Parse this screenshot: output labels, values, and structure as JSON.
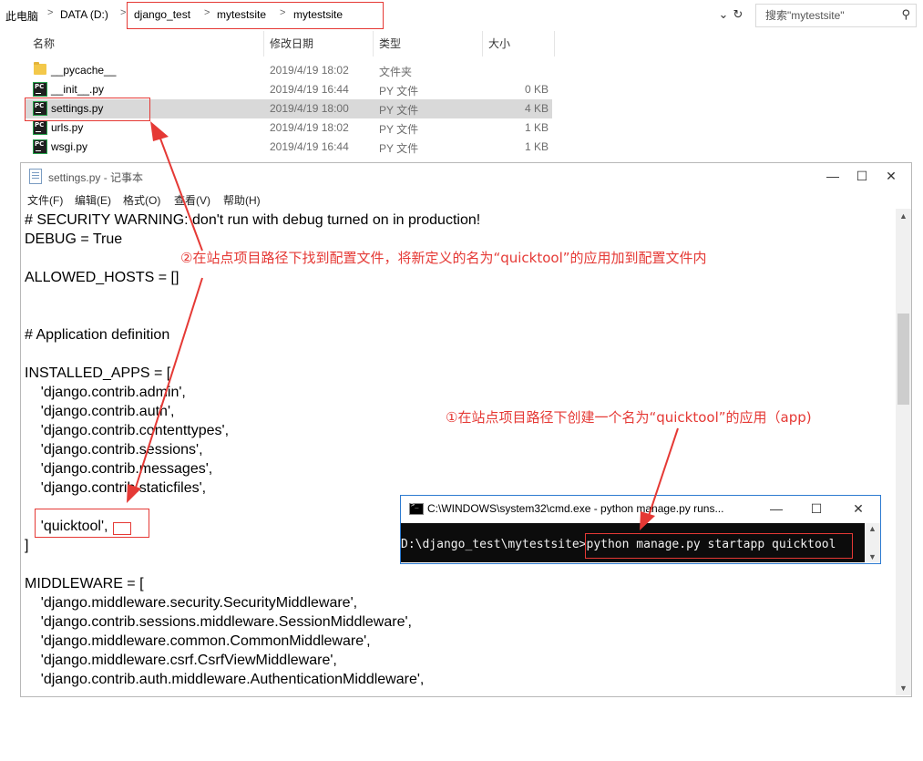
{
  "explorer": {
    "breadcrumbs": [
      "此电脑",
      "DATA (D:)",
      "django_test",
      "mytestsite",
      "mytestsite"
    ],
    "search_placeholder": "搜索\"mytestsite\"",
    "columns": {
      "name": "名称",
      "modified": "修改日期",
      "type": "类型",
      "size": "大小"
    },
    "files": [
      {
        "name": "__pycache__",
        "modified": "2019/4/19 18:02",
        "type": "文件夹",
        "size": "",
        "icon": "folder-icon"
      },
      {
        "name": "__init__.py",
        "modified": "2019/4/19 16:44",
        "type": "PY 文件",
        "size": "0 KB",
        "icon": "pycharm-file-icon"
      },
      {
        "name": "settings.py",
        "modified": "2019/4/19 18:00",
        "type": "PY 文件",
        "size": "4 KB",
        "icon": "pycharm-file-icon",
        "selected": true
      },
      {
        "name": "urls.py",
        "modified": "2019/4/19 18:02",
        "type": "PY 文件",
        "size": "1 KB",
        "icon": "pycharm-file-icon"
      },
      {
        "name": "wsgi.py",
        "modified": "2019/4/19 16:44",
        "type": "PY 文件",
        "size": "1 KB",
        "icon": "pycharm-file-icon"
      }
    ]
  },
  "notepad": {
    "title": "settings.py - 记事本",
    "menu": [
      "文件(F)",
      "编辑(E)",
      "格式(O)",
      "查看(V)",
      "帮助(H)"
    ],
    "lines": [
      "# SECURITY WARNING: don't run with debug turned on in production!",
      "DEBUG = True",
      "",
      "ALLOWED_HOSTS = []",
      "",
      "",
      "# Application definition",
      "",
      "INSTALLED_APPS = [",
      "    'django.contrib.admin',",
      "    'django.contrib.auth',",
      "    'django.contrib.contenttypes',",
      "    'django.contrib.sessions',",
      "    'django.contrib.messages',",
      "    'django.contrib.staticfiles',",
      "",
      "    'quicktool',",
      "]",
      "",
      "MIDDLEWARE = [",
      "    'django.middleware.security.SecurityMiddleware',",
      "    'django.contrib.sessions.middleware.SessionMiddleware',",
      "    'django.middleware.common.CommonMiddleware',",
      "    'django.middleware.csrf.CsrfViewMiddleware',",
      "    'django.contrib.auth.middleware.AuthenticationMiddleware',"
    ]
  },
  "cmd": {
    "title": "C:\\WINDOWS\\system32\\cmd.exe - python  manage.py runs...",
    "prompt": "D:\\django_test\\mytestsite>",
    "command": "python manage.py startapp quicktool"
  },
  "annotations": {
    "step2": "②在站点项目路径下找到配置文件，将新定义的名为“quicktool”的应用加到配置文件内",
    "step1": "①在站点项目路径下创建一个名为“quicktool”的应用（app)",
    "color": "#e53935"
  }
}
